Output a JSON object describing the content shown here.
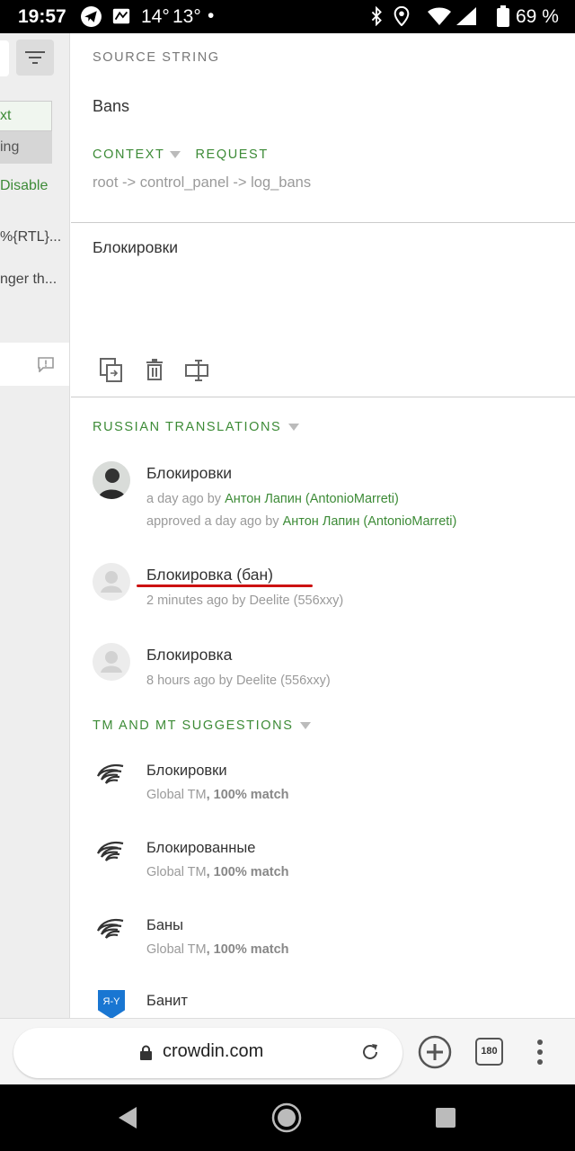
{
  "status_bar": {
    "time": "19:57",
    "temp1": "14°",
    "temp2": "13°",
    "dot": "•",
    "battery": "69 %"
  },
  "left_panel": {
    "item1": "xt",
    "item2": "ing",
    "item3": "Disable",
    "item4": "%{RTL}...",
    "item5": "nger th..."
  },
  "source": {
    "heading": "SOURCE STRING",
    "text": "Bans",
    "context_label": "CONTEXT",
    "request_label": "REQUEST",
    "context_path": "root -> control_panel -> log_bans"
  },
  "editor": {
    "value": "Блокировки"
  },
  "translations": {
    "heading": "RUSSIAN TRANSLATIONS",
    "items": [
      {
        "text": "Блокировки",
        "meta_prefix": "a day ago by ",
        "meta_user": "Антон Лапин (AntonioMarreti)",
        "approved_prefix": "approved a day ago by ",
        "approved_user": "Антон Лапин (AntonioMarreti)"
      },
      {
        "text": "Блокировка (бан)",
        "meta": "2 minutes ago by Deelite (556xxy)"
      },
      {
        "text": "Блокировка",
        "meta": "8 hours ago by Deelite (556xxy)"
      }
    ]
  },
  "suggestions": {
    "heading": "TM AND MT SUGGESTIONS",
    "items": [
      {
        "text": "Блокировки",
        "source": "Global TM",
        "match": ", 100% match"
      },
      {
        "text": "Блокированные",
        "source": "Global TM",
        "match": ", 100% match"
      },
      {
        "text": "Баны",
        "source": "Global TM",
        "match": ", 100% match"
      },
      {
        "text": "Банит",
        "badge": "Я-Y"
      }
    ]
  },
  "browser": {
    "url": "crowdin.com",
    "tab_count": "180"
  },
  "colors": {
    "accent_green": "#3d8b37",
    "underline_red": "#cc1111"
  }
}
